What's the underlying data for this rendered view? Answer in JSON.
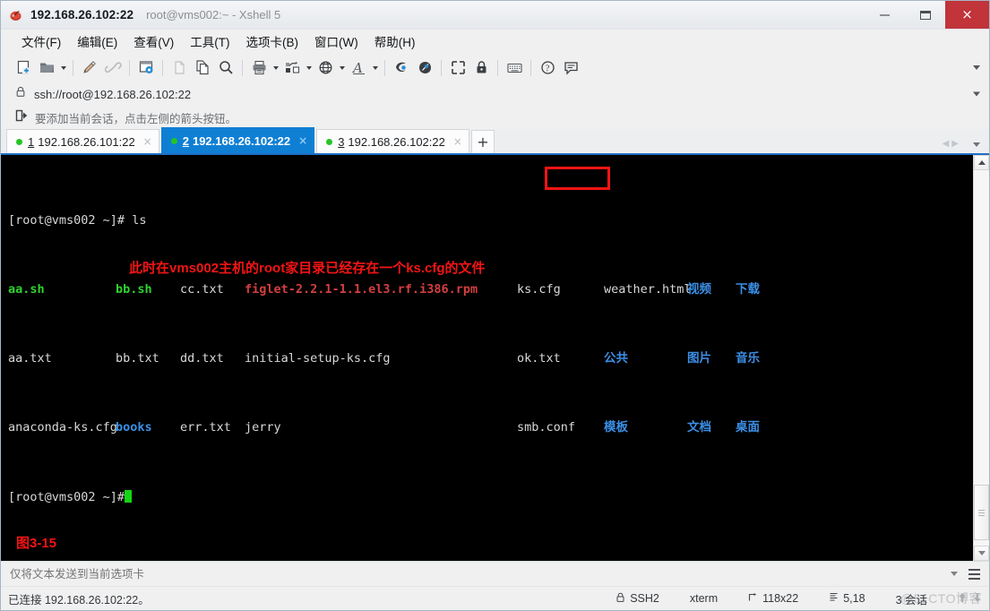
{
  "window": {
    "title_main": "192.168.26.102:22",
    "title_sub": "root@vms002:~ - Xshell 5",
    "app_icon": "xshell-logo-icon",
    "minimize_label": "—",
    "maximize_label": "❐",
    "close_label": "×"
  },
  "menubar": {
    "items": [
      {
        "label": "文件(F)",
        "name": "menu-file"
      },
      {
        "label": "编辑(E)",
        "name": "menu-edit"
      },
      {
        "label": "查看(V)",
        "name": "menu-view"
      },
      {
        "label": "工具(T)",
        "name": "menu-tools"
      },
      {
        "label": "选项卡(B)",
        "name": "menu-tabs"
      },
      {
        "label": "窗口(W)",
        "name": "menu-window"
      },
      {
        "label": "帮助(H)",
        "name": "menu-help"
      }
    ]
  },
  "toolbar": {
    "icons": [
      "new-session-icon",
      "open-folder-icon",
      "folder-dropdown-caret",
      "separator",
      "edit-pencil-icon",
      "link-chain-icon",
      "separator",
      "session-properties-icon",
      "separator",
      "paste-blank-icon",
      "copy-icon",
      "find-icon",
      "separator",
      "print-icon",
      "print-dropdown-caret",
      "transfer-file-icon",
      "transfer-dropdown-caret",
      "globe-icon",
      "globe-dropdown-caret",
      "font-icon",
      "font-dropdown-caret",
      "separator",
      "ssh-tunnel-icon",
      "sftp-icon",
      "separator",
      "fullscreen-icon",
      "lock-icon",
      "separator",
      "keyboard-icon",
      "separator",
      "help-icon",
      "chat-icon"
    ],
    "overflow": "toolbar-overflow-caret"
  },
  "address": {
    "lock_icon": "lock-icon",
    "url": "ssh://root@192.168.26.102:22",
    "dropdown": "address-dropdown-caret"
  },
  "hint": {
    "icon": "add-session-icon",
    "text": "要添加当前会话，点击左侧的箭头按钮。"
  },
  "tabs": {
    "items": [
      {
        "num": "1",
        "label": "192.168.26.101:22",
        "active": false,
        "close": "×"
      },
      {
        "num": "2",
        "label": "192.168.26.102:22",
        "active": true,
        "close": "×"
      },
      {
        "num": "3",
        "label": "192.168.26.102:22",
        "active": false,
        "close": "×"
      }
    ],
    "add_label": "+",
    "nav_prev": "◀",
    "nav_next": "▶"
  },
  "terminal": {
    "prompt": "[root@vms002 ~]#",
    "command": "ls",
    "prompt2": "[root@vms002 ~]#",
    "rows": [
      {
        "cols": [
          {
            "text": "aa.sh",
            "color": "green"
          },
          {
            "text": "bb.sh",
            "color": "green"
          },
          {
            "text": "cc.txt",
            "color": "white"
          },
          {
            "text": "figlet-2.2.1-1.1.el3.rf.i386.rpm",
            "color": "red"
          },
          {
            "text": "ks.cfg",
            "color": "white"
          },
          {
            "text": "weather.html",
            "color": "white"
          },
          {
            "text": "视频",
            "color": "blue"
          },
          {
            "text": "下载",
            "color": "blue"
          }
        ]
      },
      {
        "cols": [
          {
            "text": "aa.txt",
            "color": "white"
          },
          {
            "text": "bb.txt",
            "color": "white"
          },
          {
            "text": "dd.txt",
            "color": "white"
          },
          {
            "text": "initial-setup-ks.cfg",
            "color": "white"
          },
          {
            "text": "ok.txt",
            "color": "white"
          },
          {
            "text": "公共",
            "color": "blue"
          },
          {
            "text": "图片",
            "color": "blue"
          },
          {
            "text": "音乐",
            "color": "blue"
          }
        ]
      },
      {
        "cols": [
          {
            "text": "anaconda-ks.cfg",
            "color": "white"
          },
          {
            "text": "books",
            "color": "blue"
          },
          {
            "text": "err.txt",
            "color": "white"
          },
          {
            "text": "jerry",
            "color": "white"
          },
          {
            "text": "smb.conf",
            "color": "white"
          },
          {
            "text": "模板",
            "color": "blue"
          },
          {
            "text": "文档",
            "color": "blue"
          },
          {
            "text": "桌面",
            "color": "blue"
          }
        ]
      }
    ],
    "annotation": "此时在vms002主机的root家目录已经存在一个ks.cfg的文件",
    "figure_label": "图3-15",
    "highlight_target": "ks.cfg",
    "colors": {
      "background": "#000000",
      "foreground": "#d8d8d8",
      "green": "#2fd32f",
      "blue": "#3b8fe6",
      "red": "#d33f3f",
      "cursor": "#13d613",
      "annotation_red": "#f41414"
    }
  },
  "sendbar": {
    "placeholder": "仅将文本发送到当前选项卡",
    "value": "",
    "dropdown": "send-dropdown-caret",
    "menu_icon": "hamburger-menu-icon"
  },
  "statusbar": {
    "connection": "已连接 192.168.26.102:22。",
    "protocol": "SSH2",
    "protocol_icon": "lock-icon",
    "terminal_type": "xterm",
    "size": "118x22",
    "size_icon": "resize-icon",
    "cursor_position": "5,18",
    "cursor_icon": "cursor-position-icon",
    "sessions": "3 会话",
    "upload_icon": "upload-arrow-icon",
    "download_icon": "download-arrow-icon",
    "watermark": "@51CTO博客"
  }
}
